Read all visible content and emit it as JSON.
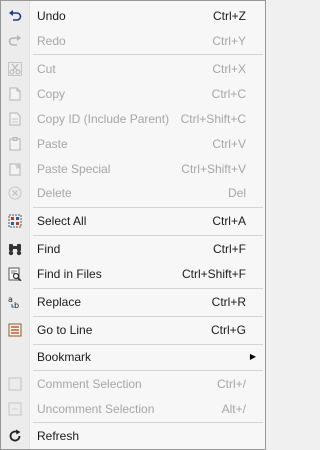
{
  "menu": {
    "items": [
      {
        "label": "Undo",
        "shortcut": "Ctrl+Z",
        "enabled": true,
        "icon": "undo-icon"
      },
      {
        "label": "Redo",
        "shortcut": "Ctrl+Y",
        "enabled": false,
        "icon": "redo-icon"
      },
      {
        "label": "Cut",
        "shortcut": "Ctrl+X",
        "enabled": false,
        "icon": "cut-icon"
      },
      {
        "label": "Copy",
        "shortcut": "Ctrl+C",
        "enabled": false,
        "icon": "copy-icon"
      },
      {
        "label": "Copy ID (Include Parent)",
        "shortcut": "Ctrl+Shift+C",
        "enabled": false,
        "icon": "copy-id-icon"
      },
      {
        "label": "Paste",
        "shortcut": "Ctrl+V",
        "enabled": false,
        "icon": "paste-icon"
      },
      {
        "label": "Paste Special",
        "shortcut": "Ctrl+Shift+V",
        "enabled": false,
        "icon": "paste-special-icon"
      },
      {
        "label": "Delete",
        "shortcut": "Del",
        "enabled": false,
        "icon": "delete-icon"
      },
      {
        "label": "Select All",
        "shortcut": "Ctrl+A",
        "enabled": true,
        "icon": "select-all-icon"
      },
      {
        "label": "Find",
        "shortcut": "Ctrl+F",
        "enabled": true,
        "icon": "binoculars-icon"
      },
      {
        "label": "Find in Files",
        "shortcut": "Ctrl+Shift+F",
        "enabled": true,
        "icon": "find-in-files-icon"
      },
      {
        "label": "Replace",
        "shortcut": "Ctrl+R",
        "enabled": true,
        "icon": "replace-icon"
      },
      {
        "label": "Go to Line",
        "shortcut": "Ctrl+G",
        "enabled": true,
        "icon": "go-to-line-icon"
      },
      {
        "label": "Bookmark",
        "shortcut": "",
        "enabled": true,
        "icon": "",
        "submenu": true
      },
      {
        "label": "Comment Selection",
        "shortcut": "Ctrl+/",
        "enabled": false,
        "icon": "comment-icon"
      },
      {
        "label": "Uncomment Selection",
        "shortcut": "Alt+/",
        "enabled": false,
        "icon": "uncomment-icon"
      },
      {
        "label": "Refresh",
        "shortcut": "",
        "enabled": true,
        "icon": "refresh-icon"
      }
    ]
  }
}
